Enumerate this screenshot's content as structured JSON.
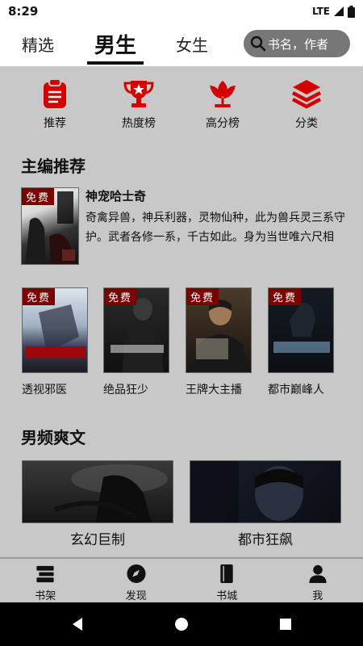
{
  "status": {
    "time": "8:29",
    "network": "LTE"
  },
  "tabs": [
    {
      "label": "精选"
    },
    {
      "label": "男生"
    },
    {
      "label": "女生"
    }
  ],
  "search": {
    "placeholder": "书名，作者"
  },
  "categories": [
    {
      "label": "推荐",
      "icon": "clipboard-icon"
    },
    {
      "label": "热度榜",
      "icon": "trophy-icon"
    },
    {
      "label": "高分榜",
      "icon": "flower-icon"
    },
    {
      "label": "分类",
      "icon": "layers-icon"
    }
  ],
  "editor_pick": {
    "title": "主编推荐",
    "featured": {
      "free_tag": "免费",
      "name": "神宠哈士奇",
      "description": "奇禽异兽，神兵利器，灵物仙种，此为兽兵灵三系守护。武者各修一系，千古如此。身为当世唯六尺相"
    },
    "books": [
      {
        "name": "透视邪医",
        "free_tag": "免费"
      },
      {
        "name": "绝品狂少",
        "free_tag": "免费"
      },
      {
        "name": "王牌大主播",
        "free_tag": "免费"
      },
      {
        "name": "都市巅峰人",
        "free_tag": "免费"
      }
    ]
  },
  "male_genre": {
    "title": "男频爽文",
    "items": [
      {
        "name": "玄幻巨制"
      },
      {
        "name": "都市狂飙"
      }
    ]
  },
  "bottom_nav": [
    {
      "label": "书架",
      "icon": "bookshelf-icon"
    },
    {
      "label": "发现",
      "icon": "compass-icon"
    },
    {
      "label": "书城",
      "icon": "book-icon"
    },
    {
      "label": "我",
      "icon": "person-icon"
    }
  ],
  "colors": {
    "accent": "#d40000",
    "tab_active": "#111111",
    "background": "#c8c8c8"
  }
}
